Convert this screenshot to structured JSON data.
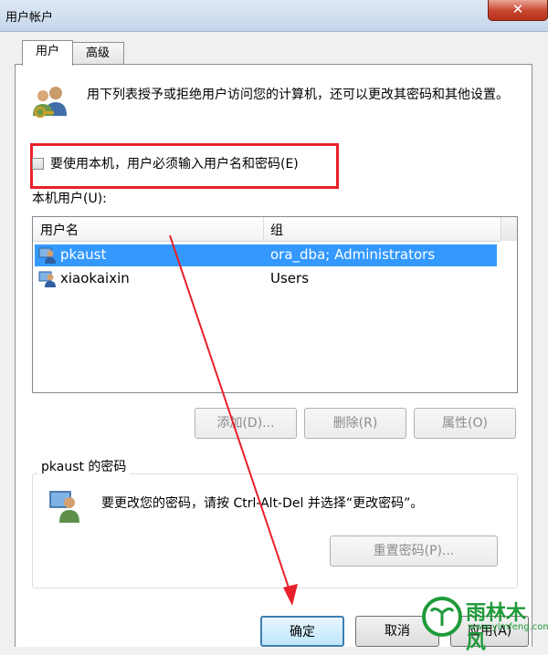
{
  "window": {
    "title": "用户帐户",
    "close_glyph": "✕"
  },
  "tabs": [
    {
      "label": "用户",
      "active": true
    },
    {
      "label": "高级",
      "active": false
    }
  ],
  "intro_text": "用下列表授予或拒绝用户访问您的计算机，还可以更改其密码和其他设置。",
  "require_login": {
    "label": "要使用本机，用户必须输入用户名和密码(E)",
    "checked": false
  },
  "local_users_label": "本机用户(U):",
  "table": {
    "columns": [
      "用户名",
      "组"
    ],
    "rows": [
      {
        "name": "pkaust",
        "group": "ora_dba; Administrators",
        "selected": true
      },
      {
        "name": "xiaokaixin",
        "group": "Users",
        "selected": false
      }
    ]
  },
  "buttons": {
    "add": "添加(D)...",
    "remove": "删除(R)",
    "properties": "属性(O)",
    "reset_password": "重置密码(P)...",
    "ok": "确定",
    "cancel": "取消",
    "apply": "应用(A)"
  },
  "password_group": {
    "title": "pkaust 的密码",
    "text": "要更改您的密码，请按 Ctrl-Alt-Del 并选择“更改密码”。"
  },
  "watermark": {
    "text": "雨林木风",
    "url": "www.ylmfeng.com"
  },
  "colors": {
    "annotation_red": "#e8202a",
    "selection_blue": "#3399ff",
    "watermark_green": "#1f9b3a"
  }
}
